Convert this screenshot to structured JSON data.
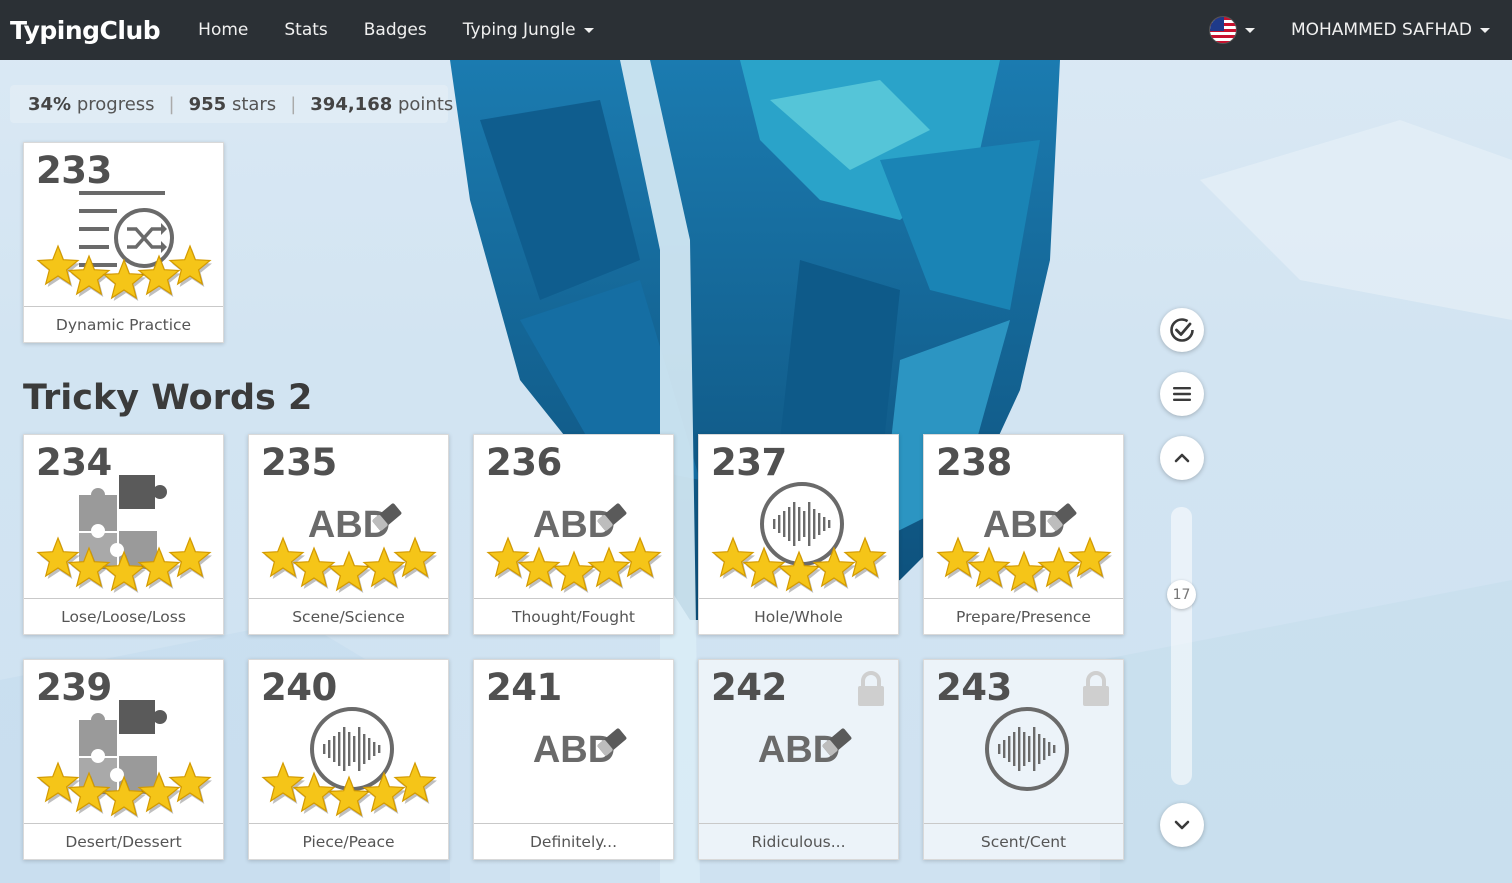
{
  "navbar": {
    "brand": "TypingClub",
    "links": [
      "Home",
      "Stats",
      "Badges",
      "Typing Jungle"
    ],
    "user": "MOHAMMED SAFHAD"
  },
  "progress": {
    "percent": "34%",
    "percent_label": "progress",
    "stars": "955",
    "stars_label": "stars",
    "points": "394,168",
    "points_label": "points"
  },
  "section_title": "Tricky Words 2",
  "lessons": [
    {
      "num": "233",
      "label": "Dynamic Practice",
      "icon": "shuffle-list-icon",
      "stars": 5,
      "locked": false
    },
    {
      "num": "234",
      "label": "Lose/Loose/Loss",
      "icon": "puzzle-icon",
      "stars": 5,
      "locked": false
    },
    {
      "num": "235",
      "label": "Scene/Science",
      "icon": "abc-eraser-icon",
      "stars": 5,
      "locked": false
    },
    {
      "num": "236",
      "label": "Thought/Fought",
      "icon": "abc-eraser-icon",
      "stars": 5,
      "locked": false
    },
    {
      "num": "237",
      "label": "Hole/Whole",
      "icon": "soundwave-icon",
      "stars": 5,
      "locked": false
    },
    {
      "num": "238",
      "label": "Prepare/Presence",
      "icon": "abc-eraser-icon",
      "stars": 5,
      "locked": false
    },
    {
      "num": "239",
      "label": "Desert/Dessert",
      "icon": "puzzle-icon",
      "stars": 5,
      "locked": false
    },
    {
      "num": "240",
      "label": "Piece/Peace",
      "icon": "soundwave-icon",
      "stars": 5,
      "locked": false
    },
    {
      "num": "241",
      "label": "Definitely...",
      "icon": "abc-eraser-icon",
      "stars": 0,
      "locked": false
    },
    {
      "num": "242",
      "label": "Ridiculous...",
      "icon": "abc-eraser-icon",
      "stars": 0,
      "locked": true
    },
    {
      "num": "243",
      "label": "Scent/Cent",
      "icon": "soundwave-icon",
      "stars": 0,
      "locked": true
    }
  ],
  "icon_text": {
    "abc": "ABD"
  },
  "controls": {
    "icons": [
      "check-circle-icon",
      "menu-icon",
      "chevron-up-icon",
      "chevron-down-icon"
    ],
    "slider_value": "17"
  },
  "colors": {
    "navbar": "#2b3035",
    "star": "#f5c518",
    "card_text": "#505050"
  }
}
